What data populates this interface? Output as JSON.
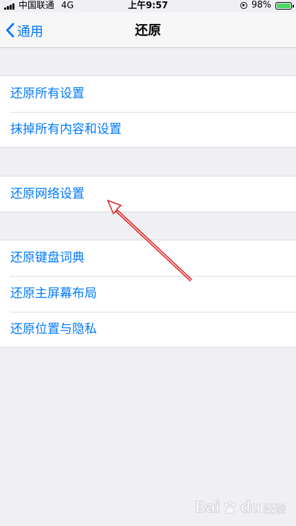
{
  "status_bar": {
    "carrier": "中国联通",
    "network": "4G",
    "time": "上午9:57",
    "battery": "98%",
    "battery_level": 0.98,
    "battery_color": "#4cd964"
  },
  "nav": {
    "back_label": "通用",
    "title": "还原",
    "accent_color": "#007aff"
  },
  "groups": [
    {
      "items": [
        {
          "label": "还原所有设置"
        },
        {
          "label": "抹掉所有内容和设置"
        }
      ]
    },
    {
      "items": [
        {
          "label": "还原网络设置"
        }
      ]
    },
    {
      "items": [
        {
          "label": "还原键盘词典"
        },
        {
          "label": "还原主屏幕布局"
        },
        {
          "label": "还原位置与隐私"
        }
      ]
    }
  ],
  "annotation": {
    "color": "#e02424",
    "icon": "red-arrow-icon"
  },
  "watermark": {
    "brand": "Bai",
    "brand_suffix": "du",
    "sub": "经验",
    "icon": "paw-icon"
  }
}
